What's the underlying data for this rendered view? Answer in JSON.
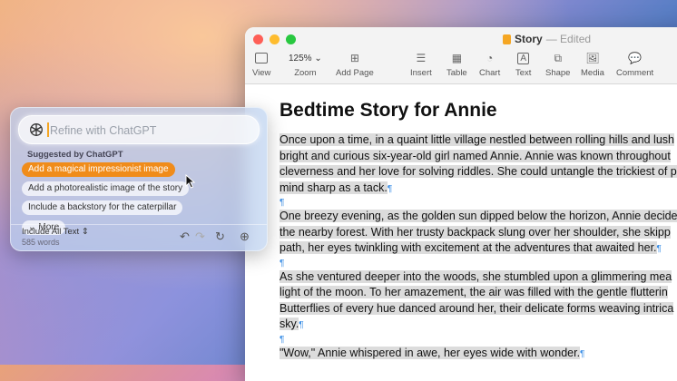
{
  "window": {
    "title": "Story",
    "status": "— Edited"
  },
  "toolbar": {
    "view": "View",
    "zoom_value": "125%",
    "zoom": "Zoom",
    "add_page": "Add Page",
    "insert": "Insert",
    "table": "Table",
    "chart": "Chart",
    "text": "Text",
    "shape": "Shape",
    "media": "Media",
    "comment": "Comment"
  },
  "document": {
    "heading": "Bedtime Story for Annie",
    "paragraphs": [
      [
        "Once upon a time, in a quaint little village nestled between rolling hills and lush",
        "bright and curious six-year-old girl named Annie. Annie was known throughout",
        "cleverness and her love for solving riddles. She could untangle the trickiest of p",
        "mind sharp as a tack."
      ],
      [
        "One breezy evening, as the golden sun dipped below the horizon, Annie decide",
        "the nearby forest. With her trusty backpack slung over her shoulder, she skipp",
        "path, her eyes twinkling with excitement at the adventures that awaited her."
      ],
      [
        "As she ventured deeper into the woods, she stumbled upon a glimmering mea",
        "light of the moon. To her amazement, the air was filled with the gentle flutterin",
        "Butterflies of every hue danced around her, their delicate forms weaving intrica",
        "sky."
      ],
      [
        "\"Wow,\" Annie whispered in awe, her eyes wide with wonder."
      ]
    ],
    "pilcrow": "¶"
  },
  "chatgpt_panel": {
    "placeholder": "Refine with ChatGPT",
    "suggested_label": "Suggested by ChatGPT",
    "suggestions": [
      "Add a magical impressionist image",
      "Add a photorealistic image of the story",
      "Include a backstory for the caterpillar"
    ],
    "more": "More",
    "include_label": "Include All Text",
    "word_count": "585 words",
    "accent_color": "#f08c1a"
  }
}
